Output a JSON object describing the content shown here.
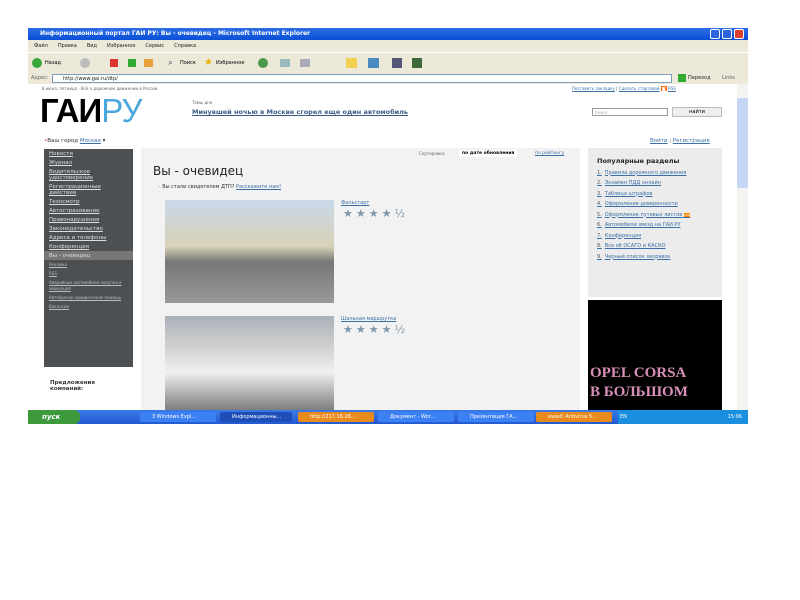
{
  "window": {
    "title": "Информационный портал ГАИ РУ: Вы - очевидец - Microsoft Internet Explorer"
  },
  "menu": [
    "Файл",
    "Правка",
    "Вид",
    "Избранное",
    "Сервис",
    "Справка"
  ],
  "toolbar": {
    "back": "Назад",
    "search": "Поиск",
    "favorites": "Избранное"
  },
  "address": {
    "label": "Адрес:",
    "url": "http://www.gai.ru/dtp/",
    "go": "Переход",
    "links": "Links"
  },
  "site": {
    "topline": "8 июня, пятница  ·  Всё о дорожном движении в России",
    "top_links": [
      "Поставить закладку",
      "Сделать стартовой",
      "RSS"
    ],
    "logo_black": "ГАИ",
    "logo_blue": "РУ",
    "day_topic_label": "Темы дня",
    "headline": "Минувшей ночью в Москве сгорел еще один автомобиль",
    "search_placeholder": "поиск",
    "search_button": "найти",
    "city_label": "Ваш город",
    "city": "Москва",
    "login": "Войти",
    "register": "Регистрация",
    "nav": [
      "Новости",
      "Журнал",
      "Водительское удостоверение",
      "Регистрационные действия",
      "Техосмотр",
      "Автострахование",
      "Правонарушения",
      "Законодательство",
      "Адреса и телефоны",
      "Конференция",
      "Вы - очевидец"
    ],
    "nav_small": [
      "Реклама",
      "RSS",
      "Аварийные автомобили покупка и эвакуация",
      "Автоброкер юридическая помощь",
      "Вакансии"
    ],
    "offers": "Предложения компаний:",
    "sort_label": "Сортировка:",
    "sort_active": "по дате обновления",
    "sort_other": "по рейтингу",
    "page_title": "Вы - очевидец",
    "witness_text": "Вы стали свидетелем ДТП?",
    "witness_link": "Расскажите нам!",
    "items": [
      {
        "title": "Фальстарт",
        "rating": 4.5
      },
      {
        "title": "Шальная маршрутка",
        "rating": 4.5
      }
    ],
    "popular_title": "Популярные разделы",
    "popular": [
      "Правила дорожного движения",
      "Экзамен ПДД онлайн",
      "Таблица штрафов",
      "Оформление доверенности",
      "Оформление путевых листов",
      "Автомобили звезд на ГАИ.РУ",
      "Конференция",
      "Все об ОСАГО и КАСКО",
      "Черный список заправок"
    ],
    "ad_line1": "OPEL CORSA",
    "ad_line2": "В БОЛЬШОМ"
  },
  "taskbar": {
    "start": "пуск",
    "items": [
      "3 Windows Expl...",
      "Информационны...",
      "http://217.16.28...",
      "Документ - Wor...",
      "Презентация ГА...",
      "avast! Antivirus 5..."
    ],
    "lang": "EN",
    "clock": "15:06"
  }
}
